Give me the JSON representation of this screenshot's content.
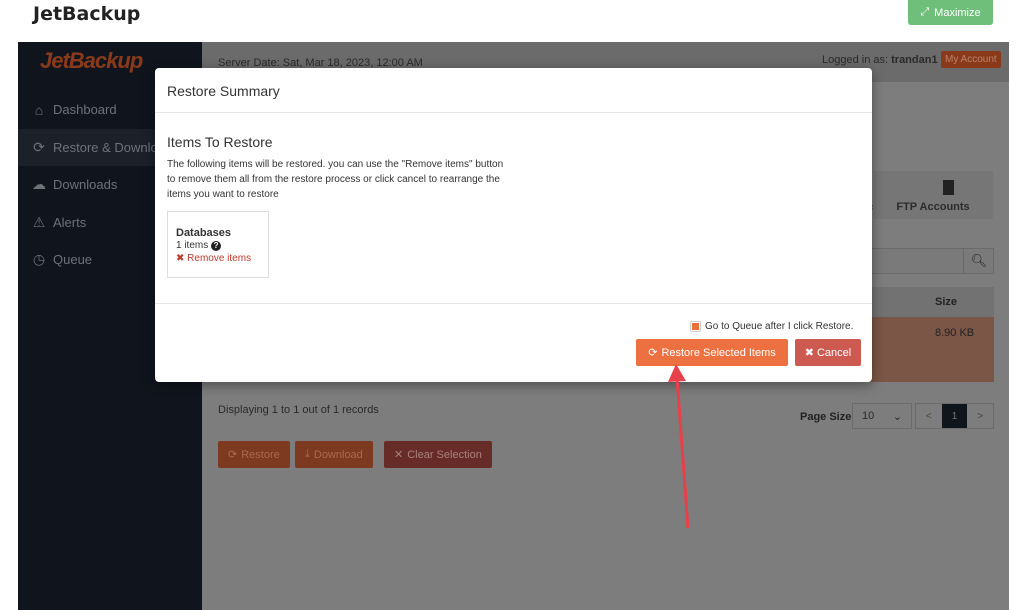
{
  "app_title": "JetBackup",
  "maximize_label": "Maximize",
  "logo_text": "JetBackup",
  "sidebar": {
    "items": [
      {
        "label": "Dashboard",
        "icon": "home-icon"
      },
      {
        "label": "Restore & Downloads",
        "icon": "refresh-icon",
        "active": true
      },
      {
        "label": "Downloads",
        "icon": "cloud-download-icon"
      },
      {
        "label": "Alerts",
        "icon": "warning-icon"
      },
      {
        "label": "Queue",
        "icon": "clock-icon"
      }
    ]
  },
  "header": {
    "server_date": "Server Date: Sat, Mar 18, 2023, 12:00 AM",
    "logged_in_prefix": "Logged in as: ",
    "username": "trandan1",
    "separator": "|",
    "my_account": "My Account"
  },
  "tabs": {
    "partial": "ounts",
    "ftp": "FTP Accounts"
  },
  "table": {
    "size_header": "Size",
    "rows": [
      {
        "size": "8.90 KB"
      }
    ]
  },
  "pagination": {
    "displaying": "Displaying 1 to 1 out of 1 records",
    "page_size_label": "Page Size",
    "page_size": "10",
    "prev": "<",
    "current": "1",
    "next": ">"
  },
  "actions": {
    "restore": "Restore",
    "download": "Download",
    "clear": "Clear Selection"
  },
  "modal": {
    "title": "Restore Summary",
    "subtitle": "Items To Restore",
    "description": "The following items will be restored. you can use the \"Remove items\" button to remove them all from the restore process or click cancel to rearrange the items you want to restore",
    "card": {
      "name": "Databases",
      "count": "1 items",
      "remove": "Remove items"
    },
    "goto_queue": "Go to Queue after I click Restore.",
    "goto_queue_checked": true,
    "restore_button": "Restore Selected Items",
    "cancel_button": "Cancel"
  },
  "colors": {
    "accent": "#ed7140",
    "danger": "#cd5a51",
    "success": "#6fbf7a",
    "sidebar": "#10151d",
    "annotation_arrow": "#e8404a"
  }
}
